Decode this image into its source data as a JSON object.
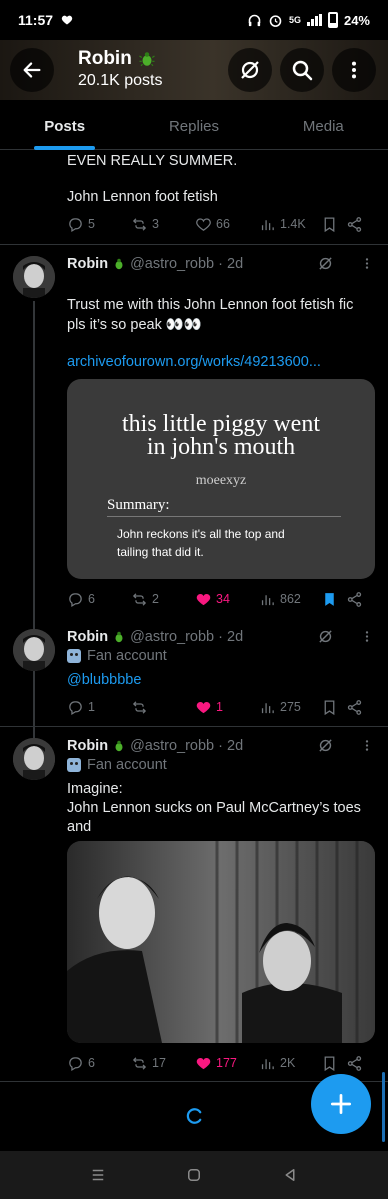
{
  "status_bar": {
    "time": "11:57",
    "network": "5G",
    "battery": "24%"
  },
  "header": {
    "name": "Robin",
    "posts_count": "20.1K posts"
  },
  "tabs": [
    "Posts",
    "Replies",
    "Media"
  ],
  "accent": "#1d9bf0",
  "like_color": "#f91880",
  "tweet0": {
    "text_line1": "EVEN REALLY SUMMER.",
    "text_line2": "John Lennon foot fetish",
    "replies": "5",
    "retweets": "3",
    "likes": "66",
    "views": "1.4K"
  },
  "tweet1": {
    "name": "Robin",
    "handle": "@astro_robb · 2d",
    "text_line1": "Trust me with this John Lennon foot fetish fic",
    "text_line2": "pls it’s so peak 👀👀",
    "link": "archiveofourown.org/works/49213600...",
    "card": {
      "title_line1": "this little piggy went",
      "title_line2": "in john's mouth",
      "author": "moeexyz",
      "summary_label": "Summary:",
      "summary_line1": "John reckons it's all the top and",
      "summary_line2": "tailing that did it."
    },
    "replies": "6",
    "retweets": "2",
    "likes": "34",
    "views": "862"
  },
  "tweet2": {
    "name": "Robin",
    "handle": "@astro_robb · 2d",
    "badge": "Fan account",
    "mention": "@blubbbbe",
    "replies": "1",
    "retweets": "",
    "likes": "1",
    "views": "275"
  },
  "tweet3": {
    "name": "Robin",
    "handle": "@astro_robb · 2d",
    "badge": "Fan account",
    "text_line1": "Imagine:",
    "text_line2": "John Lennon sucks on Paul McCartney’s toes",
    "text_line3": "and",
    "replies": "6",
    "retweets": "17",
    "likes": "177",
    "views": "2K"
  },
  "icons": {
    "back": "arrow-left-icon",
    "no_sync": "sync-off-icon",
    "search": "search-icon",
    "more": "more-vertical-icon",
    "reply": "reply-icon",
    "retweet": "retweet-icon",
    "like": "heart-icon",
    "views": "views-icon",
    "bookmark": "bookmark-icon",
    "share": "share-icon",
    "compose": "plus-icon"
  }
}
